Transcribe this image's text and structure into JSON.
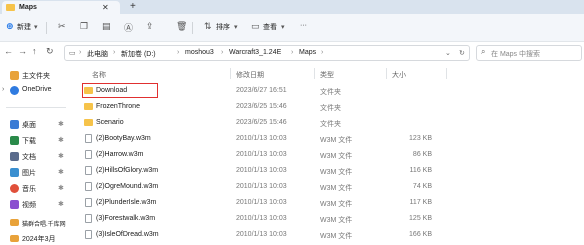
{
  "window": {
    "tab_title": "Maps",
    "tab_close": "✕",
    "new_tab": "+"
  },
  "toolbar": {
    "new_label": "新建",
    "sort_label": "排序",
    "view_label": "查看",
    "more": "···"
  },
  "address": {
    "breadcrumbs": [
      "此电脑",
      "新加卷 (D:)",
      "moshou3",
      "Warcraft3_1.24E",
      "Maps"
    ],
    "search_placeholder": "在 Maps 中搜索"
  },
  "sidebar": {
    "items": [
      {
        "label": "主文件夹",
        "color": "#e8a23a"
      },
      {
        "label": "OneDrive",
        "color": "#2f7be0"
      },
      {
        "label": "桌面",
        "color": "#3a7bd5"
      },
      {
        "label": "下载",
        "color": "#2a8a4a"
      },
      {
        "label": "文档",
        "color": "#5a6b8c"
      },
      {
        "label": "图片",
        "color": "#3a8fd0"
      },
      {
        "label": "音乐",
        "color": "#e0503a"
      },
      {
        "label": "视频",
        "color": "#8a4fd0"
      },
      {
        "label": "猫群合唱.千库网",
        "color": "#e8a23a"
      },
      {
        "label": "2024年3月",
        "color": "#e8a23a"
      }
    ]
  },
  "columns": {
    "name": "名称",
    "date": "修改日期",
    "type": "类型",
    "size": "大小"
  },
  "files": [
    {
      "name": "Download",
      "date": "2023/6/27 16:51",
      "type": "文件夹",
      "size": "",
      "kind": "folder"
    },
    {
      "name": "FrozenThrone",
      "date": "2023/6/25 15:46",
      "type": "文件夹",
      "size": "",
      "kind": "folder"
    },
    {
      "name": "Scenario",
      "date": "2023/6/25 15:46",
      "type": "文件夹",
      "size": "",
      "kind": "folder"
    },
    {
      "name": "(2)BootyBay.w3m",
      "date": "2010/1/13 10:03",
      "type": "W3M 文件",
      "size": "123 KB",
      "kind": "file"
    },
    {
      "name": "(2)Harrow.w3m",
      "date": "2010/1/13 10:03",
      "type": "W3M 文件",
      "size": "86 KB",
      "kind": "file"
    },
    {
      "name": "(2)HillsOfGlory.w3m",
      "date": "2010/1/13 10:03",
      "type": "W3M 文件",
      "size": "116 KB",
      "kind": "file"
    },
    {
      "name": "(2)OgreMound.w3m",
      "date": "2010/1/13 10:03",
      "type": "W3M 文件",
      "size": "74 KB",
      "kind": "file"
    },
    {
      "name": "(2)PlunderIsle.w3m",
      "date": "2010/1/13 10:03",
      "type": "W3M 文件",
      "size": "117 KB",
      "kind": "file"
    },
    {
      "name": "(3)Forestwalk.w3m",
      "date": "2010/1/13 10:03",
      "type": "W3M 文件",
      "size": "125 KB",
      "kind": "file"
    },
    {
      "name": "(3)IsleOfDread.w3m",
      "date": "2010/1/13 10:03",
      "type": "W3M 文件",
      "size": "166 KB",
      "kind": "file"
    }
  ]
}
